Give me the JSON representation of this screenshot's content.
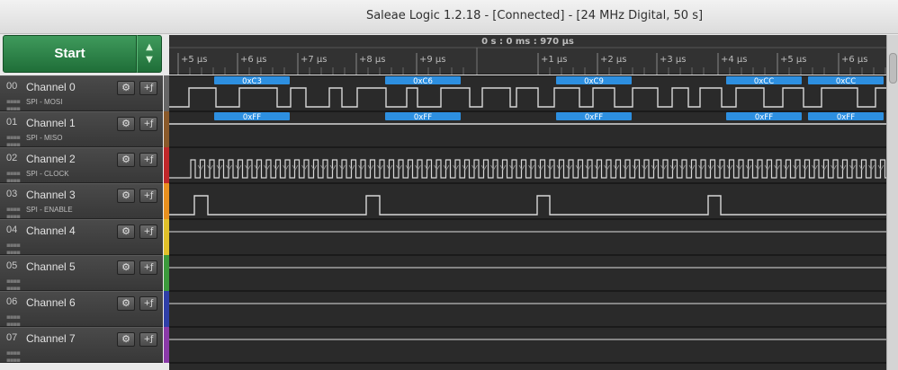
{
  "window": {
    "title": "Saleae Logic 1.2.18 - [Connected] - [24 MHz Digital, 50 s]"
  },
  "toolbar": {
    "start_label": "Start",
    "up_arrow": "▲",
    "down_arrow": "▼"
  },
  "timeline": {
    "cursor": "0 s : 0 ms : 970 µs",
    "ticks": [
      "+5 µs",
      "+6 µs",
      "+7 µs",
      "+8 µs",
      "+9 µs",
      "+1 µs",
      "+2 µs",
      "+3 µs",
      "+4 µs",
      "+5 µs",
      "+6 µs"
    ]
  },
  "icons": {
    "settings": "gear-icon",
    "add_analyzer": "trigger-icon",
    "grip": "grip-icon"
  },
  "channels": [
    {
      "num": "00",
      "name": "Channel 0",
      "sub": "SPI - MOSI",
      "color": "#666666"
    },
    {
      "num": "01",
      "name": "Channel 1",
      "sub": "SPI - MISO",
      "color": "#8a5a2b"
    },
    {
      "num": "02",
      "name": "Channel 2",
      "sub": "SPI - CLOCK",
      "color": "#c0282b"
    },
    {
      "num": "03",
      "name": "Channel 3",
      "sub": "SPI - ENABLE",
      "color": "#e8901f"
    },
    {
      "num": "04",
      "name": "Channel 4",
      "sub": "",
      "color": "#e0c02a"
    },
    {
      "num": "05",
      "name": "Channel 5",
      "sub": "",
      "color": "#3c9a3c"
    },
    {
      "num": "06",
      "name": "Channel 6",
      "sub": "",
      "color": "#2f3fa8"
    },
    {
      "num": "07",
      "name": "Channel 7",
      "sub": "",
      "color": "#8a3aa8"
    }
  ],
  "decodes": {
    "mosi": [
      "0xC3",
      "0xC6",
      "0xC9",
      "0xCC",
      "0xCC"
    ],
    "miso": [
      "0xFF",
      "0xFF",
      "0xFF",
      "0xFF",
      "0xFF"
    ]
  },
  "colors": {
    "decode": "#2d8fe0",
    "signal": "#d8d8d8",
    "background": "#2a2a2a"
  }
}
